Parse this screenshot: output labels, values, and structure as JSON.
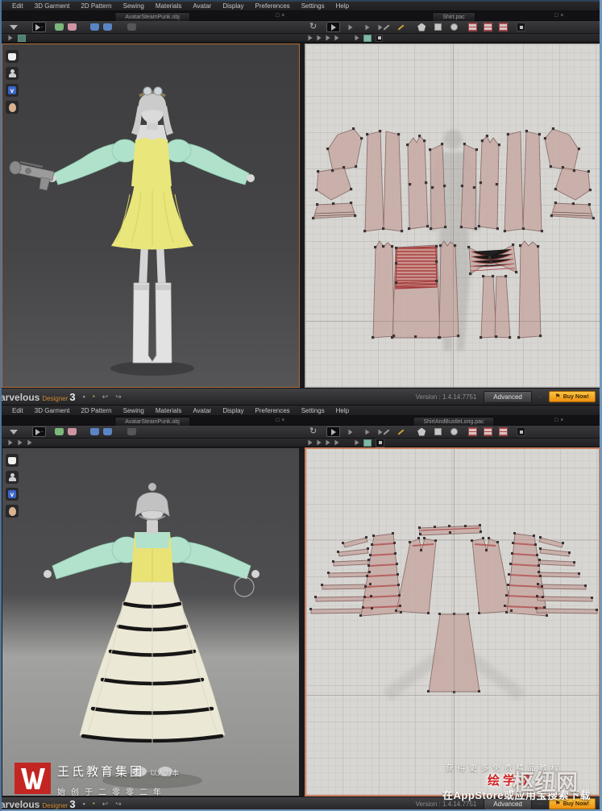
{
  "colors": {
    "accent_selected_3d": "#b06a35",
    "accent_selected_2d": "#cc8060",
    "pattern_fill": "#c7a9a3",
    "pattern_stroke": "#8d716c",
    "shirring_red": "#b04040",
    "dress_yellow": "#e9e67b",
    "sleeve_mint": "#b0e2cb",
    "skirt_cream": "#ece8d6",
    "buy_orange": "#ee9110",
    "logo_red": "#c32522"
  },
  "icons": {
    "sync": "↻",
    "undo": "↩",
    "redo": "↪",
    "restore": "□",
    "close": "×",
    "flag": "⚑",
    "save": "▪",
    "swatch": "▪",
    "dot": "·",
    "blue_v": "v"
  },
  "menu_items": [
    "Edit",
    "3D Garment",
    "2D Pattern",
    "Sewing",
    "Materials",
    "Avatar",
    "Display",
    "Preferences",
    "Settings",
    "Help"
  ],
  "screenshot_top": {
    "tab_3d": "AvatarSteamPunk.obj",
    "tab_2d": "Shirt.pac"
  },
  "screenshot_bottom": {
    "tab_3d": "AvatarSteamPunk.obj",
    "tab_2d": "ShirtAndBustleLong.pac"
  },
  "titlebar": {
    "brand_rest": "arvelous",
    "brand_designer": "Designer",
    "brand_num": "3",
    "version_label": "Version :",
    "version_value": "1.4.14.7751",
    "advanced_label": "Advanced",
    "buy_label": "Buy Now!"
  },
  "watermarks": {
    "left": {
      "org": "王氏教育集团",
      "slogan": "以人为本",
      "founded": "始创于二零零二年"
    },
    "right": {
      "line1": "获得更多免费精品教程",
      "brand": "绘学霸",
      "site": "枢纽网",
      "line2": "在AppStore或应用宝搜索下载"
    }
  }
}
